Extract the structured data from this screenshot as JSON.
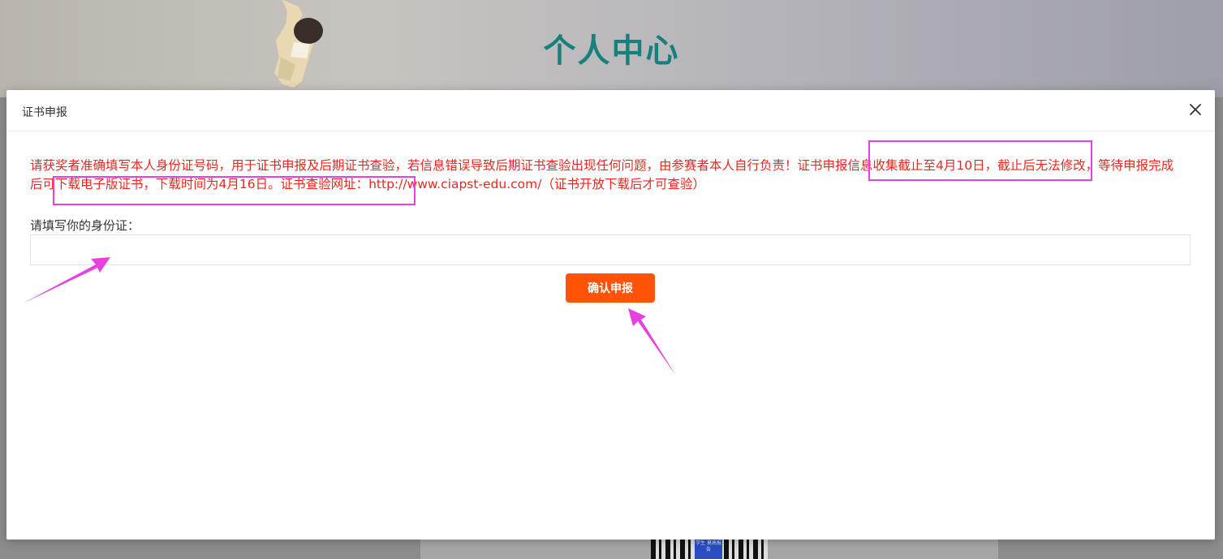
{
  "page": {
    "title": "个人中心"
  },
  "modal": {
    "title": "证书申报",
    "notice_part1": "请获奖者准确填写本人身份证号码，用于证书申报及后期证书查验，若信息错误导致后期证书查验出现任何问题，由参赛者本人自行负责！",
    "notice_highlight1": "证书申报信息收集截止至4月10日，",
    "notice_part2": "截止后无法修改，",
    "notice_highlight2": "等待申报完成后可下载电子版证书，下载时间为4月16日。",
    "notice_part3": "证书查验网址：http://www.ciapst-edu.com/（证书开放下载后才可查验）",
    "id_label": "请填写你的身份证：",
    "id_value": "",
    "id_placeholder": "",
    "confirm_label": "确认申报"
  },
  "background": {
    "qr_badge_text": "学生 莫高报告"
  },
  "colors": {
    "notice_red": "#e8281f",
    "confirm_orange": "#ff5308",
    "title_teal": "#15807c",
    "annotation_pink": "#e640e0"
  },
  "icons": {
    "close": "close-icon"
  }
}
